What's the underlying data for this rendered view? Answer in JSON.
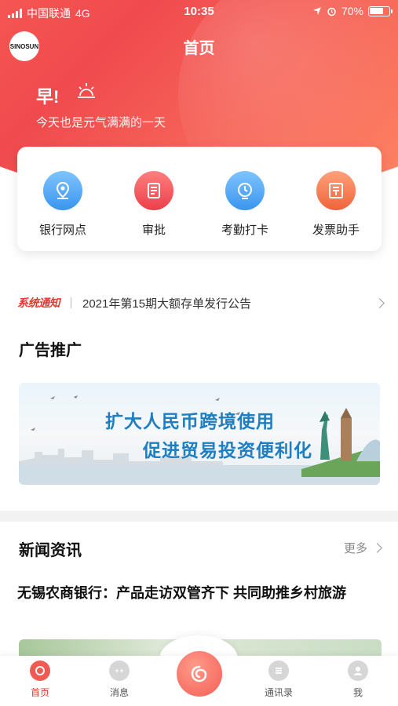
{
  "status_bar": {
    "carrier": "中国联通",
    "network": "4G",
    "time": "10:35",
    "battery": "70%"
  },
  "header": {
    "logo_text": "SINOSUN",
    "title": "首页",
    "greeting": "早!",
    "greeting_sub": "今天也是元气满满的一天"
  },
  "quick_actions": [
    {
      "label": "银行网点",
      "icon": "location-map-icon",
      "color": "#4aa3f0"
    },
    {
      "label": "审批",
      "icon": "document-approval-icon",
      "color": "#f2545b"
    },
    {
      "label": "考勤打卡",
      "icon": "clock-icon",
      "color": "#4aa3f0"
    },
    {
      "label": "发票助手",
      "icon": "invoice-icon",
      "color": "#f47a4a"
    }
  ],
  "notice": {
    "tag": "系统通知",
    "text": "2021年第15期大额存单发行公告"
  },
  "ad": {
    "section_title": "广告推广",
    "line1": "扩大人民币跨境使用",
    "line2": "促进贸易投资便利化"
  },
  "news": {
    "section_title": "新闻资讯",
    "more_label": "更多",
    "items": [
      {
        "title": "无锡农商银行：产品走访双管齐下 共同助推乡村旅游"
      }
    ]
  },
  "tabbar": {
    "tabs": [
      {
        "label": "首页",
        "icon": "home-icon",
        "active": true
      },
      {
        "label": "消息",
        "icon": "message-icon",
        "active": false
      },
      {
        "label": "通讯录",
        "icon": "contacts-icon",
        "active": false
      },
      {
        "label": "我",
        "icon": "profile-icon",
        "active": false
      }
    ]
  },
  "colors": {
    "brand_red": "#e5392f",
    "accent_blue": "#1e7ec2"
  }
}
